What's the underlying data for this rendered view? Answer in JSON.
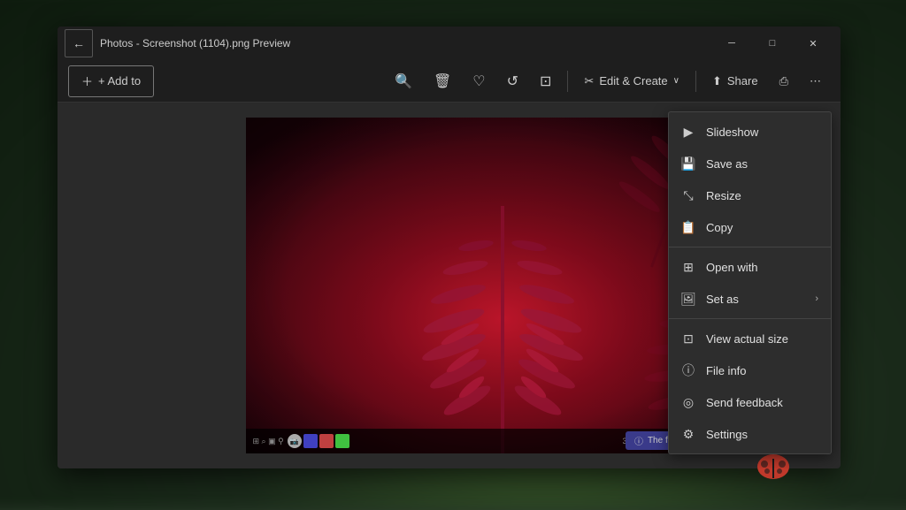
{
  "window": {
    "title": "Photos - Screenshot (1104).png Preview",
    "back_icon": "←",
    "min_icon": "─",
    "max_icon": "□",
    "close_icon": "✕"
  },
  "toolbar": {
    "add_to_label": "+ Add to",
    "zoom_in_icon": "🔍",
    "delete_icon": "🗑",
    "favorite_icon": "♡",
    "rotate_icon": "↺",
    "crop_icon": "⊡",
    "edit_create_icon": "✂",
    "edit_create_label": "Edit & Create",
    "chevron_icon": "∨",
    "share_icon": "⬆",
    "share_label": "Share",
    "print_icon": "⎙",
    "more_icon": "⋯"
  },
  "context_menu": {
    "items": [
      {
        "id": "slideshow",
        "icon": "▶",
        "label": "Slideshow",
        "has_sub": false
      },
      {
        "id": "save-as",
        "icon": "💾",
        "label": "Save as",
        "has_sub": false
      },
      {
        "id": "resize",
        "icon": "⤡",
        "label": "Resize",
        "has_sub": false
      },
      {
        "id": "copy",
        "icon": "📋",
        "label": "Copy",
        "has_sub": false
      },
      {
        "id": "open-with",
        "icon": "⊞",
        "label": "Open with",
        "has_sub": false
      },
      {
        "id": "set-as",
        "icon": "🖼",
        "label": "Set as",
        "has_sub": true
      },
      {
        "id": "view-actual",
        "icon": "⊡",
        "label": "View actual size",
        "has_sub": false
      },
      {
        "id": "file-info",
        "icon": "ⓘ",
        "label": "File info",
        "has_sub": false
      },
      {
        "id": "send-feedback",
        "icon": "◎",
        "label": "Send feedback",
        "has_sub": false
      },
      {
        "id": "settings",
        "icon": "⚙",
        "label": "Settings",
        "has_sub": false
      }
    ],
    "divider_after": [
      3,
      5
    ]
  },
  "notification": {
    "icon": "ⓘ",
    "text": "The file didn't download."
  },
  "expand_icon": "⤢"
}
